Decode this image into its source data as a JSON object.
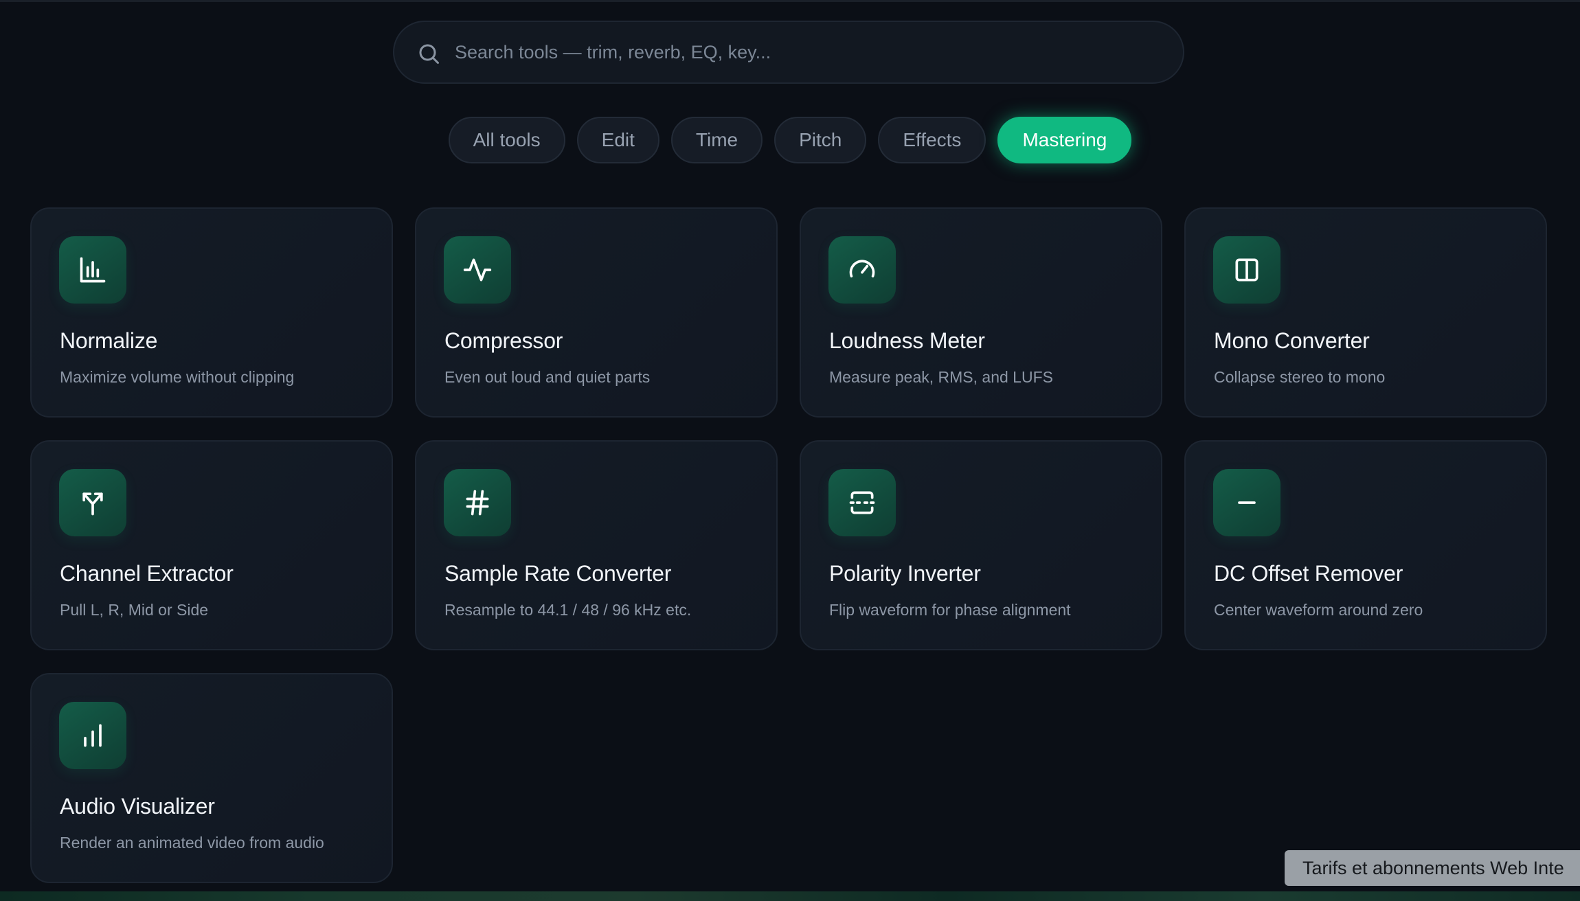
{
  "search": {
    "placeholder": "Search tools — trim, reverb, EQ, key..."
  },
  "tabs": [
    {
      "label": "All tools",
      "active": false
    },
    {
      "label": "Edit",
      "active": false
    },
    {
      "label": "Time",
      "active": false
    },
    {
      "label": "Pitch",
      "active": false
    },
    {
      "label": "Effects",
      "active": false
    },
    {
      "label": "Mastering",
      "active": true
    }
  ],
  "cards": [
    {
      "icon": "bar-chart-icon",
      "title": "Normalize",
      "desc": "Maximize volume without clipping"
    },
    {
      "icon": "activity-icon",
      "title": "Compressor",
      "desc": "Even out loud and quiet parts"
    },
    {
      "icon": "gauge-icon",
      "title": "Loudness Meter",
      "desc": "Measure peak, RMS, and LUFS"
    },
    {
      "icon": "columns-icon",
      "title": "Mono Converter",
      "desc": "Collapse stereo to mono"
    },
    {
      "icon": "split-icon",
      "title": "Channel Extractor",
      "desc": "Pull L, R, Mid or Side"
    },
    {
      "icon": "hash-icon",
      "title": "Sample Rate Converter",
      "desc": "Resample to 44.1 / 48 / 96 kHz etc."
    },
    {
      "icon": "flip-icon",
      "title": "Polarity Inverter",
      "desc": "Flip waveform for phase alignment"
    },
    {
      "icon": "minus-icon",
      "title": "DC Offset Remover",
      "desc": "Center waveform around zero"
    },
    {
      "icon": "signal-bars-icon",
      "title": "Audio Visualizer",
      "desc": "Render an animated video from audio"
    }
  ],
  "toast": {
    "text": "Tarifs et abonnements Web Inte"
  },
  "colors": {
    "accent": "#10b981",
    "background": "#0b0f16",
    "card": "#141c26"
  }
}
